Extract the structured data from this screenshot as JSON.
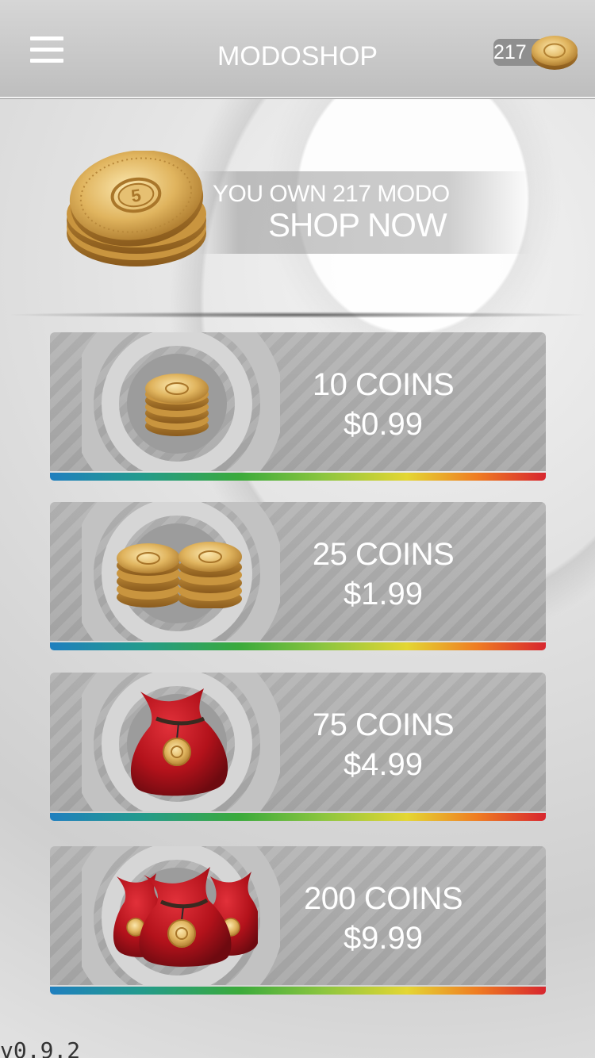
{
  "header": {
    "title": "MODOSHOP",
    "menu_icon": "hamburger-menu-icon",
    "balance": "217",
    "balance_icon": "coin-icon"
  },
  "banner": {
    "line1": "YOU OWN 217 MODO",
    "line2": "SHOP NOW",
    "icon": "coin-stack-icon"
  },
  "products": [
    {
      "coins": "10 COINS",
      "price": "$0.99",
      "icon": "coin-stack-icon"
    },
    {
      "coins": "25 COINS",
      "price": "$1.99",
      "icon": "coin-stacks-icon"
    },
    {
      "coins": "75 COINS",
      "price": "$4.99",
      "icon": "coin-bag-icon"
    },
    {
      "coins": "200 COINS",
      "price": "$9.99",
      "icon": "coin-bags-icon"
    }
  ],
  "footer": {
    "version": "v0.9.2"
  },
  "colors": {
    "gold": "#d9a94a",
    "bag_red": "#b3121b",
    "card_gray": "#acacac",
    "stripe": [
      "#1f7fbf",
      "#3aaa3c",
      "#e4d633",
      "#d7262f"
    ]
  }
}
